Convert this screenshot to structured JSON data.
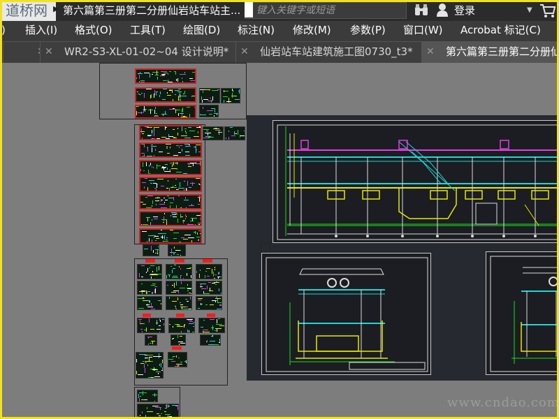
{
  "titlebar": {
    "logo_text": "道桥网",
    "document_title": "第六篇第三册第二分册仙岩站车站主...",
    "search_placeholder": "键入关键字或短语",
    "login_label": "登录"
  },
  "menubar": {
    "items": [
      "插入(I)",
      "格式(O)",
      "工具(T)",
      "绘图(D)",
      "标注(N)",
      "修改(M)",
      "参数(P)",
      "窗口(W)",
      "Acrobat 标记(C)"
    ]
  },
  "tabs": [
    {
      "label": "WR2-S3-XL-01-02~04 设计说明*",
      "active": false
    },
    {
      "label": "仙岩站车站建筑施工图0730_t3*",
      "active": false
    },
    {
      "label": "第六篇第三册第二分册仙岩",
      "active": true
    }
  ],
  "watermark": "www.cndao.com",
  "colors": {
    "frame": "#f2e21c",
    "canvas": "#7d7d7d",
    "title_bg": "#2b2b2b",
    "menu_bg": "#3b3b3b",
    "cad_cyan": "#25d4d4",
    "cad_yellow": "#e8e800",
    "cad_green": "#18e018",
    "cad_magenta": "#e040e0"
  },
  "icons": [
    "qa-dropdown-icon",
    "binoculars-icon",
    "user-icon",
    "cart-icon",
    "close-tab-icon"
  ]
}
